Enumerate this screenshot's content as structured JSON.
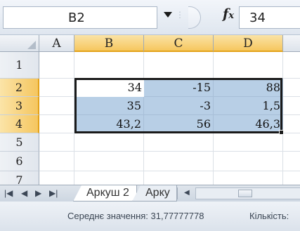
{
  "formula_bar": {
    "name_box": "B2",
    "fx_label": "fx",
    "formula_value": "34"
  },
  "columns": [
    {
      "label": "A",
      "selected": false
    },
    {
      "label": "B",
      "selected": true
    },
    {
      "label": "C",
      "selected": true
    },
    {
      "label": "D",
      "selected": true
    }
  ],
  "rows": [
    {
      "label": "1",
      "selected": false,
      "cells": [
        "",
        "",
        "",
        ""
      ]
    },
    {
      "label": "2",
      "selected": true,
      "cells": [
        "",
        "34",
        "-15",
        "88"
      ]
    },
    {
      "label": "3",
      "selected": true,
      "cells": [
        "",
        "35",
        "-3",
        "1,5"
      ]
    },
    {
      "label": "4",
      "selected": true,
      "cells": [
        "",
        "43,2",
        "56",
        "46,3"
      ]
    },
    {
      "label": "5",
      "selected": false,
      "cells": [
        "",
        "",
        "",
        ""
      ]
    },
    {
      "label": "6",
      "selected": false,
      "cells": [
        "",
        "",
        "",
        ""
      ]
    },
    {
      "label": "7",
      "selected": false,
      "cells": [
        "",
        "",
        "",
        ""
      ]
    }
  ],
  "sheet_tabs": {
    "nav_buttons": [
      "|◀",
      "◀",
      "▶",
      "▶|"
    ],
    "tabs": [
      "Аркуш 2",
      "Арку"
    ]
  },
  "status_bar": {
    "average": "Середнє значення: 31,77777778",
    "count": "Кількість:"
  },
  "colors": {
    "selection_fill": "#b8cfe6",
    "header_highlight": "#f6c75f"
  }
}
